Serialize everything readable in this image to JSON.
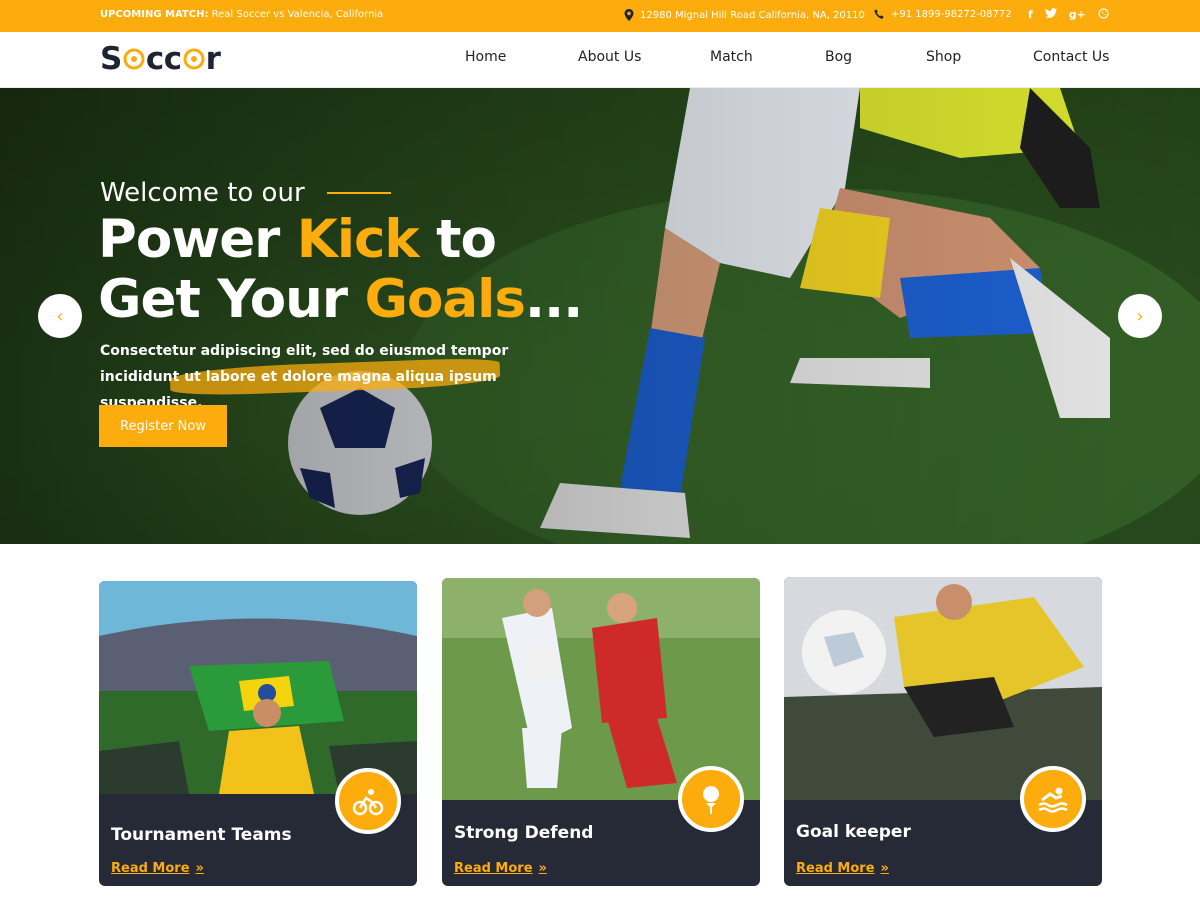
{
  "topbar": {
    "match_label": "UPCOMING MATCH:",
    "match_text": "Real Soccer vs Valencia, California",
    "address": "12980 Mignal Hill Road California, NA, 20110",
    "phone": "+91 1899-98272-08772",
    "social": [
      {
        "icon": "facebook-icon",
        "glyph": "f"
      },
      {
        "icon": "twitter-icon",
        "glyph": "t"
      },
      {
        "icon": "google-plus-icon",
        "glyph": "g+"
      },
      {
        "icon": "whatsapp-icon",
        "glyph": "w"
      }
    ]
  },
  "logo": {
    "part1": "S",
    "part2": "cc",
    "part3": "r"
  },
  "nav": {
    "items": [
      "Home",
      "About Us",
      "Match",
      "Bog",
      "Shop",
      "Contact Us"
    ]
  },
  "hero": {
    "welcome": "Welcome to our",
    "line1_a": "Power ",
    "line1_accent": "Kick",
    "line1_b": " to",
    "line2_a": "Get Your ",
    "line2_accent": "Goals",
    "line2_b": "...",
    "text": "Consectetur adipiscing elit, sed do eiusmod tempor incididunt ut labore et dolore magna aliqua ipsum suspendisse.",
    "button": "Register Now",
    "prev": "‹",
    "next": "›"
  },
  "cards": [
    {
      "title": "Tournament Teams",
      "link": "Read More",
      "icon": "cycling-icon"
    },
    {
      "title": "Strong Defend",
      "link": "Read More",
      "icon": "golf-tee-icon"
    },
    {
      "title": "Goal keeper",
      "link": "Read More",
      "icon": "swimming-icon"
    }
  ],
  "colors": {
    "accent": "#fcac0c",
    "dark": "#262a36"
  }
}
